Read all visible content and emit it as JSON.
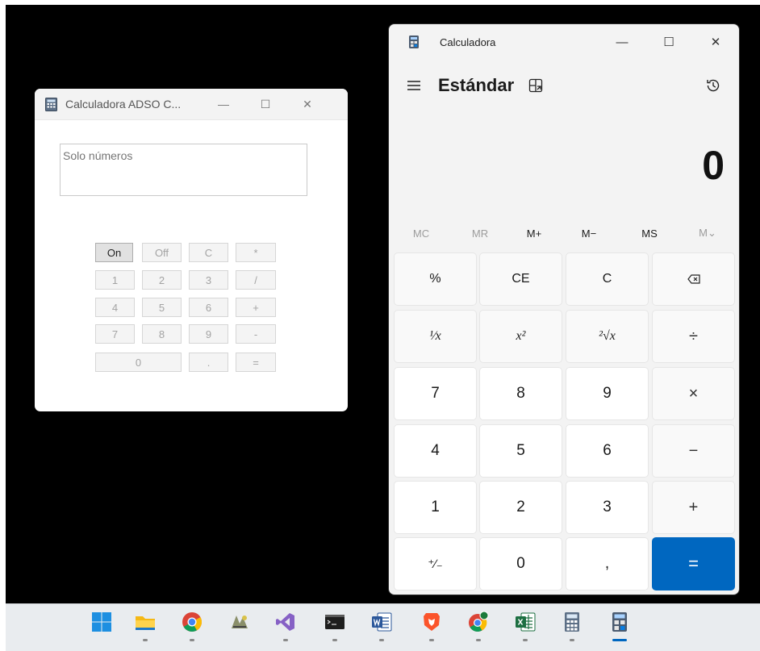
{
  "small_window": {
    "title": "Calculadora ADSO C...",
    "minimize": "—",
    "maximize": "☐",
    "close": "✕",
    "input_placeholder": "Solo números",
    "buttons": {
      "on": "On",
      "off": "Off",
      "clear": "C",
      "mul": "*",
      "b1": "1",
      "b2": "2",
      "b3": "3",
      "div": "/",
      "b4": "4",
      "b5": "5",
      "b6": "6",
      "add": "+",
      "b7": "7",
      "b8": "8",
      "b9": "9",
      "sub": "-",
      "b0": "0",
      "dot": ".",
      "eq": "="
    }
  },
  "calc": {
    "title": "Calculadora",
    "minimize": "—",
    "maximize": "☐",
    "close": "✕",
    "mode": "Estándar",
    "display": "0",
    "memory": {
      "mc": "MC",
      "mr": "MR",
      "mplus": "M+",
      "mminus": "M−",
      "ms": "MS",
      "mlist": "M⌄"
    },
    "keys": {
      "percent": "%",
      "ce": "CE",
      "c": "C",
      "backspace": "⌫",
      "recip": "¹⁄x",
      "square": "x²",
      "sqrt": "²√x",
      "div": "÷",
      "k7": "7",
      "k8": "8",
      "k9": "9",
      "mul": "×",
      "k4": "4",
      "k5": "5",
      "k6": "6",
      "sub": "−",
      "k1": "1",
      "k2": "2",
      "k3": "3",
      "add": "+",
      "negate": "⁺∕₋",
      "k0": "0",
      "decimal": ",",
      "eq": "="
    }
  },
  "taskbar": {
    "items": [
      "start-icon",
      "file-explorer-icon",
      "chrome-icon",
      "app-icon",
      "visual-studio-icon",
      "terminal-icon",
      "word-icon",
      "brave-icon",
      "chrome-profile-icon",
      "excel-icon",
      "calculator-winforms-icon",
      "calculator-icon"
    ]
  },
  "colors": {
    "accent": "#0067c0",
    "desktop": "#000000"
  }
}
